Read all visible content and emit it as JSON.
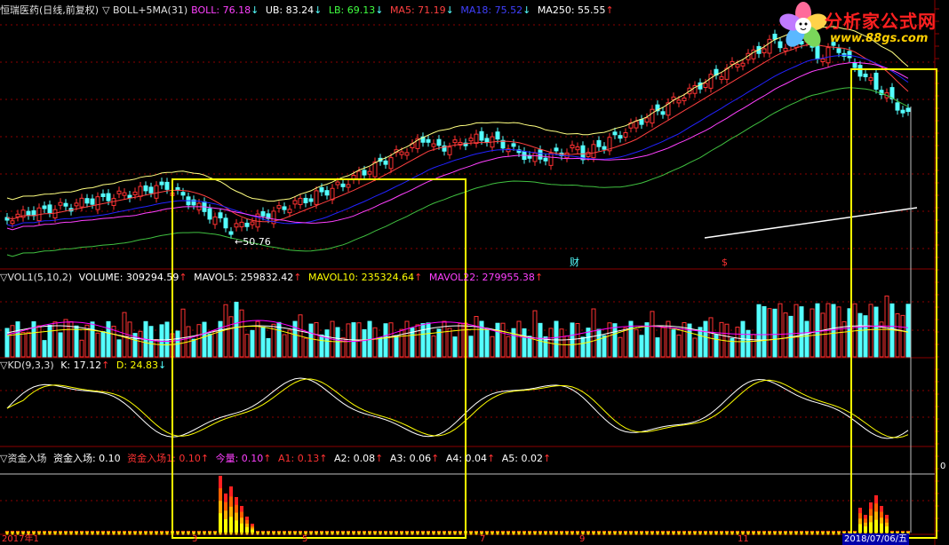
{
  "colors": {
    "up": "#ff3232",
    "down": "#54ffff",
    "boll_mid": "#ffff80",
    "ma5": "#ff4040",
    "ma18": "#2222ff",
    "ma250": "#ffffff",
    "mavol5": "#ffffff",
    "mavol10": "#ffff00",
    "mavol22": "#ff00ff",
    "k": "#ffffff",
    "d": "#ffff00",
    "highlight": "#ffff00",
    "grid": "#8b0000"
  },
  "main": {
    "title": "恒瑞医药(日线,前复权)",
    "indicator": "▽ BOLL+5MA(31)",
    "boll": "BOLL: 76.18",
    "ub": "UB: 83.24",
    "lb": "LB: 69.13",
    "ma5": "MA5: 71.19",
    "ma18": "MA18: 75.52",
    "ma250": "MA250: 55.55",
    "low_marker": "←50.76",
    "marker_cai": "财",
    "marker_s": "$"
  },
  "volume": {
    "title": "▽VOL1(5,10,2)",
    "volume": "VOLUME: 309294.59",
    "mavol5": "MAVOL5: 259832.42",
    "mavol10": "MAVOL10: 235324.64",
    "mavol22": "MAVOL22: 279955.38"
  },
  "kd": {
    "title": "▽KD(9,3,3)",
    "k": "K: 17.12",
    "d": "D: 24.83"
  },
  "fund": {
    "title": "▽资金入场",
    "value": "资金入场: 0.10",
    "v1": "资金入场1: 0.10",
    "jinliang": "今量: 0.10",
    "a1": "A1: 0.13",
    "a2": "A2: 0.08",
    "a3": "A3: 0.06",
    "a4": "A4: 0.04",
    "a5": "A5: 0.02",
    "right_tick": "0"
  },
  "axis": {
    "labels": [
      "2017年1",
      "3",
      "5",
      "7",
      "9",
      "11",
      "2018/07/06/五"
    ]
  },
  "logo": {
    "name": "分析家公式网",
    "url": "www.88gs.com"
  },
  "icons": {
    "down_arrow": "down-arrow-icon",
    "up_arrow": "up-arrow-icon",
    "logo": "flower-logo-icon"
  }
}
